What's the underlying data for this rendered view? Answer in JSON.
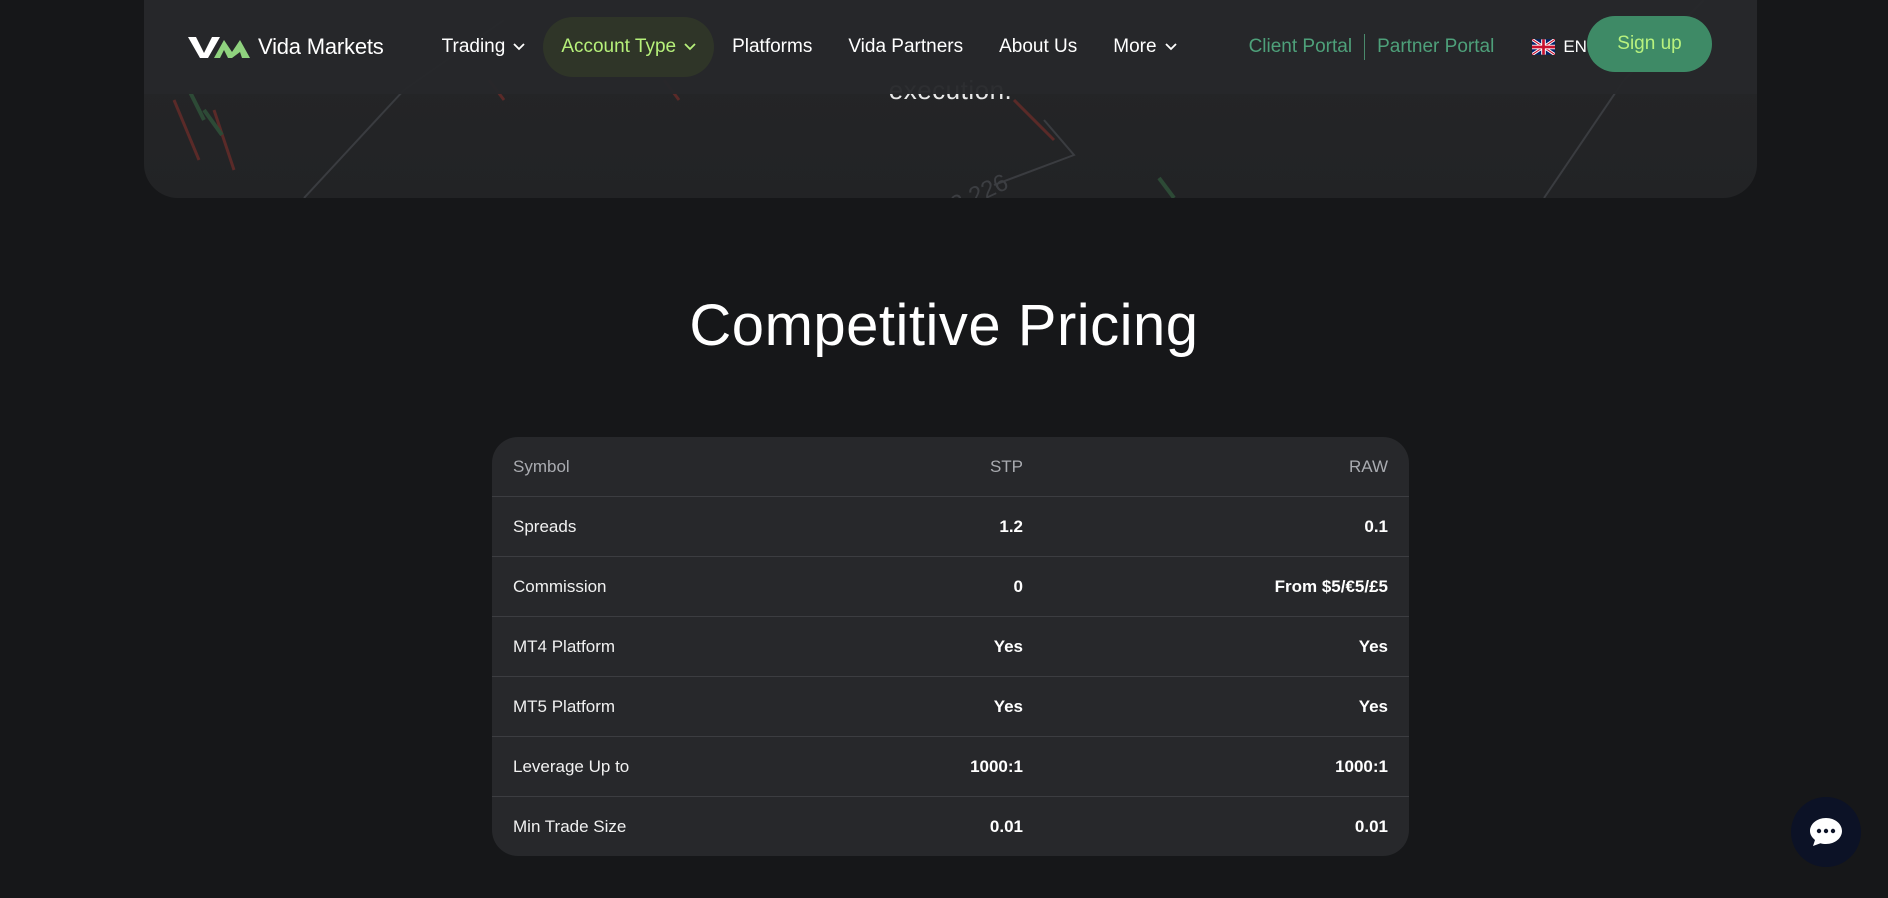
{
  "brand": {
    "name": "Vida Markets"
  },
  "nav": {
    "items": [
      {
        "label": "Trading",
        "has_dropdown": true,
        "active": false
      },
      {
        "label": "Account Type",
        "has_dropdown": true,
        "active": true
      },
      {
        "label": "Platforms",
        "has_dropdown": false,
        "active": false
      },
      {
        "label": "Vida Partners",
        "has_dropdown": false,
        "active": false
      },
      {
        "label": "About Us",
        "has_dropdown": false,
        "active": false
      },
      {
        "label": "More",
        "has_dropdown": true,
        "active": false
      }
    ],
    "client_portal": "Client Portal",
    "partner_portal": "Partner Portal",
    "language": "EN",
    "signup": "Sign up"
  },
  "hero": {
    "text_fragment": "execution."
  },
  "pricing": {
    "title": "Competitive Pricing",
    "columns": [
      "Symbol",
      "STP",
      "RAW"
    ],
    "rows": [
      {
        "label": "Spreads",
        "stp": "1.2",
        "raw": "0.1"
      },
      {
        "label": "Commission",
        "stp": "0",
        "raw": "From $5/€5/£5"
      },
      {
        "label": "MT4 Platform",
        "stp": "Yes",
        "raw": "Yes"
      },
      {
        "label": "MT5 Platform",
        "stp": "Yes",
        "raw": "Yes"
      },
      {
        "label": "Leverage Up to",
        "stp": "1000:1",
        "raw": "1000:1"
      },
      {
        "label": "Min Trade Size",
        "stp": "0.01",
        "raw": "0.01"
      }
    ]
  },
  "colors": {
    "background": "#161719",
    "accent_green": "#3e8a66",
    "accent_lime": "#b6f07a",
    "portal_link": "#4ea07a",
    "table_bg": "#27282b"
  },
  "icons": {
    "chat": "chat-bubble-icon",
    "flag": "uk-flag-icon",
    "logo": "vm-logo-mark"
  }
}
